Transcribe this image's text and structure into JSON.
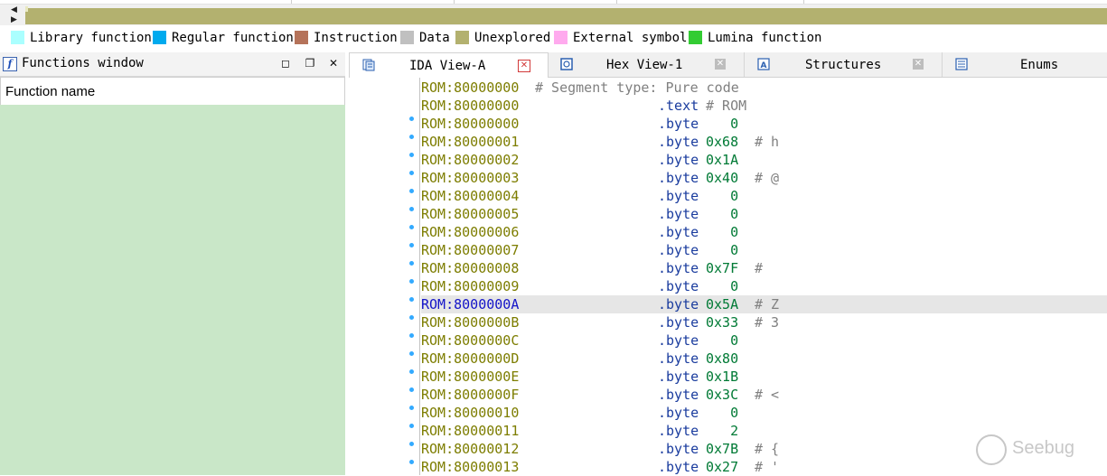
{
  "legend": [
    {
      "label": "Library function",
      "color": "#aaffff"
    },
    {
      "label": "Regular function",
      "color": "#00aaee"
    },
    {
      "label": "Instruction",
      "color": "#b5735a"
    },
    {
      "label": "Data",
      "color": "#c0c0c0"
    },
    {
      "label": "Unexplored",
      "color": "#b3b16f"
    },
    {
      "label": "External symbol",
      "color": "#ffaaee"
    },
    {
      "label": "Lumina function",
      "color": "#33cc33"
    }
  ],
  "functions_window": {
    "title": "Functions window",
    "column_header": "Function name",
    "list_bg": "#c9e7c8"
  },
  "tabs": [
    {
      "label": "IDA View-A",
      "icon": "ida-view-icon",
      "active": true
    },
    {
      "label": "Hex View-1",
      "icon": "hex-view-icon",
      "active": false
    },
    {
      "label": "Structures",
      "icon": "structures-icon",
      "active": false
    },
    {
      "label": "Enums",
      "icon": "enums-icon",
      "active": false
    }
  ],
  "code_lines": [
    {
      "addr": "ROM:80000000",
      "directive": "",
      "operand": "",
      "comment": "# Segment type: Pure code",
      "dot": false,
      "highlight": false
    },
    {
      "addr": "ROM:80000000",
      "directive": ".text",
      "operand": "",
      "comment": "# ROM",
      "dot": false,
      "highlight": false
    },
    {
      "addr": "ROM:80000000",
      "directive": ".byte",
      "operand": "   0",
      "comment": "",
      "dot": true,
      "highlight": false
    },
    {
      "addr": "ROM:80000001",
      "directive": ".byte",
      "operand": "0x68",
      "comment": "# h",
      "dot": true,
      "highlight": false
    },
    {
      "addr": "ROM:80000002",
      "directive": ".byte",
      "operand": "0x1A",
      "comment": "",
      "dot": true,
      "highlight": false
    },
    {
      "addr": "ROM:80000003",
      "directive": ".byte",
      "operand": "0x40",
      "comment": "# @",
      "dot": true,
      "highlight": false
    },
    {
      "addr": "ROM:80000004",
      "directive": ".byte",
      "operand": "   0",
      "comment": "",
      "dot": true,
      "highlight": false
    },
    {
      "addr": "ROM:80000005",
      "directive": ".byte",
      "operand": "   0",
      "comment": "",
      "dot": true,
      "highlight": false
    },
    {
      "addr": "ROM:80000006",
      "directive": ".byte",
      "operand": "   0",
      "comment": "",
      "dot": true,
      "highlight": false
    },
    {
      "addr": "ROM:80000007",
      "directive": ".byte",
      "operand": "   0",
      "comment": "",
      "dot": true,
      "highlight": false
    },
    {
      "addr": "ROM:80000008",
      "directive": ".byte",
      "operand": "0x7F",
      "comment": "#",
      "dot": true,
      "highlight": false
    },
    {
      "addr": "ROM:80000009",
      "directive": ".byte",
      "operand": "   0",
      "comment": "",
      "dot": true,
      "highlight": false
    },
    {
      "addr": "ROM:8000000A",
      "directive": ".byte",
      "operand": "0x5A",
      "comment": "# Z",
      "dot": true,
      "highlight": true
    },
    {
      "addr": "ROM:8000000B",
      "directive": ".byte",
      "operand": "0x33",
      "comment": "# 3",
      "dot": true,
      "highlight": false
    },
    {
      "addr": "ROM:8000000C",
      "directive": ".byte",
      "operand": "   0",
      "comment": "",
      "dot": true,
      "highlight": false
    },
    {
      "addr": "ROM:8000000D",
      "directive": ".byte",
      "operand": "0x80",
      "comment": "",
      "dot": true,
      "highlight": false
    },
    {
      "addr": "ROM:8000000E",
      "directive": ".byte",
      "operand": "0x1B",
      "comment": "",
      "dot": true,
      "highlight": false
    },
    {
      "addr": "ROM:8000000F",
      "directive": ".byte",
      "operand": "0x3C",
      "comment": "# <",
      "dot": true,
      "highlight": false
    },
    {
      "addr": "ROM:80000010",
      "directive": ".byte",
      "operand": "   0",
      "comment": "",
      "dot": true,
      "highlight": false
    },
    {
      "addr": "ROM:80000011",
      "directive": ".byte",
      "operand": "   2",
      "comment": "",
      "dot": true,
      "highlight": false
    },
    {
      "addr": "ROM:80000012",
      "directive": ".byte",
      "operand": "0x7B",
      "comment": "# {",
      "dot": true,
      "highlight": false
    },
    {
      "addr": "ROM:80000013",
      "directive": ".byte",
      "operand": "0x27",
      "comment": "# '",
      "dot": true,
      "highlight": false
    }
  ],
  "watermark": "Seebug",
  "colors": {
    "nav_bar": "#b3b16f",
    "highlight_row": "#e6e6e6",
    "address": "#7d7d00",
    "address_selected": "#1414c8",
    "directive": "#1a3c9e",
    "operand": "#007a35",
    "comment": "#808080"
  }
}
